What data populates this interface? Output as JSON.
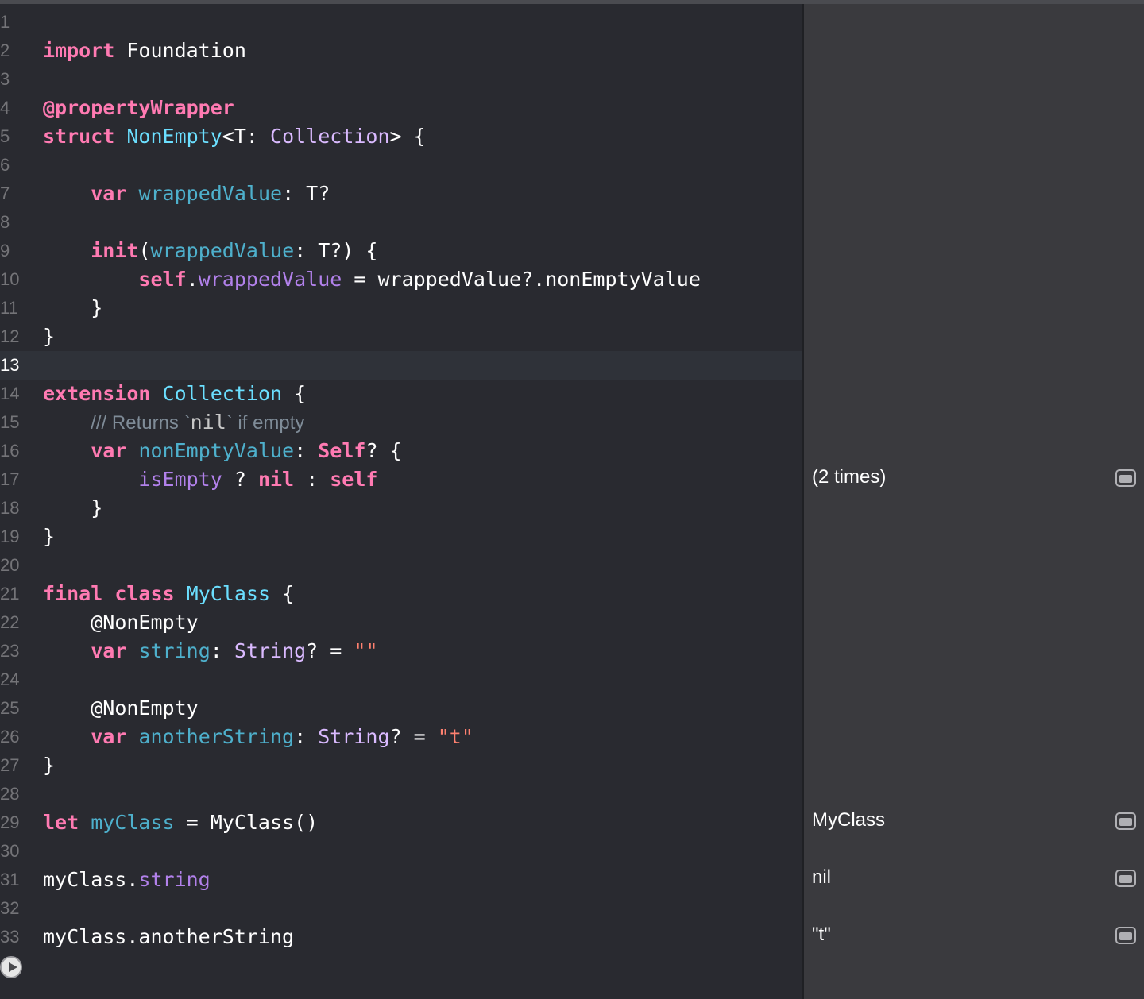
{
  "editor": {
    "lines": {
      "1": "1",
      "2": "2",
      "3": "3",
      "4": "4",
      "5": "5",
      "6": "6",
      "7": "7",
      "8": "8",
      "9": "9",
      "10": "10",
      "11": "11",
      "12": "12",
      "13": "13",
      "14": "14",
      "15": "15",
      "16": "16",
      "17": "17",
      "18": "18",
      "19": "19",
      "20": "20",
      "21": "21",
      "22": "22",
      "23": "23",
      "24": "24",
      "25": "25",
      "26": "26",
      "27": "27",
      "28": "28",
      "29": "29",
      "30": "30",
      "31": "31",
      "32": "32",
      "33": "33"
    },
    "tokens": {
      "import": "import",
      "foundation": " Foundation",
      "propertyWrapper": "@propertyWrapper",
      "struct": "struct",
      "nonEmpty": "NonEmpty",
      "lt_T": "<T: ",
      "collection": "Collection",
      "gt_brace": "> {",
      "var": "var",
      "wrappedValue": "wrappedValue",
      "colon_T_opt": ": T?",
      "init": "init",
      "paren_open": "(",
      "colon_T_opt_close": ": T?) {",
      "self": "self",
      "dot": ".",
      "assign_rhs": " = wrappedValue?.nonEmptyValue",
      "close_brace": "}",
      "extension": "extension",
      "space_brace": " {",
      "comment_slashes": "/// ",
      "comment_returns": "Returns `",
      "comment_nil": "nil",
      "comment_rest": "` if empty",
      "nonEmptyValue": "nonEmptyValue",
      "colon_sp": ": ",
      "self_type": "Self",
      "opt_brace": "? {",
      "isEmpty": "isEmpty",
      "question": " ? ",
      "nil": "nil",
      "colon_mid": " : ",
      "final": "final",
      "class": "class",
      "myClassType": "MyClass",
      "nonEmptyAttr": "@NonEmpty",
      "string": "string",
      "stringType": "String",
      "opt_eq": "? = ",
      "empty_str": "\"\"",
      "anotherString": "anotherString",
      "t_str": "\"t\"",
      "let": "let",
      "myClass": "myClass",
      "eq_ctor": " = MyClass()",
      "myClass_dot": "myClass.",
      "myClass_another": "myClass.anotherString"
    }
  },
  "results": {
    "line17": "(2 times)",
    "line29": "MyClass",
    "line31": "nil",
    "line33": "\"t\""
  },
  "icons": {
    "quicklook": "quicklook-icon",
    "run": "run-icon"
  }
}
